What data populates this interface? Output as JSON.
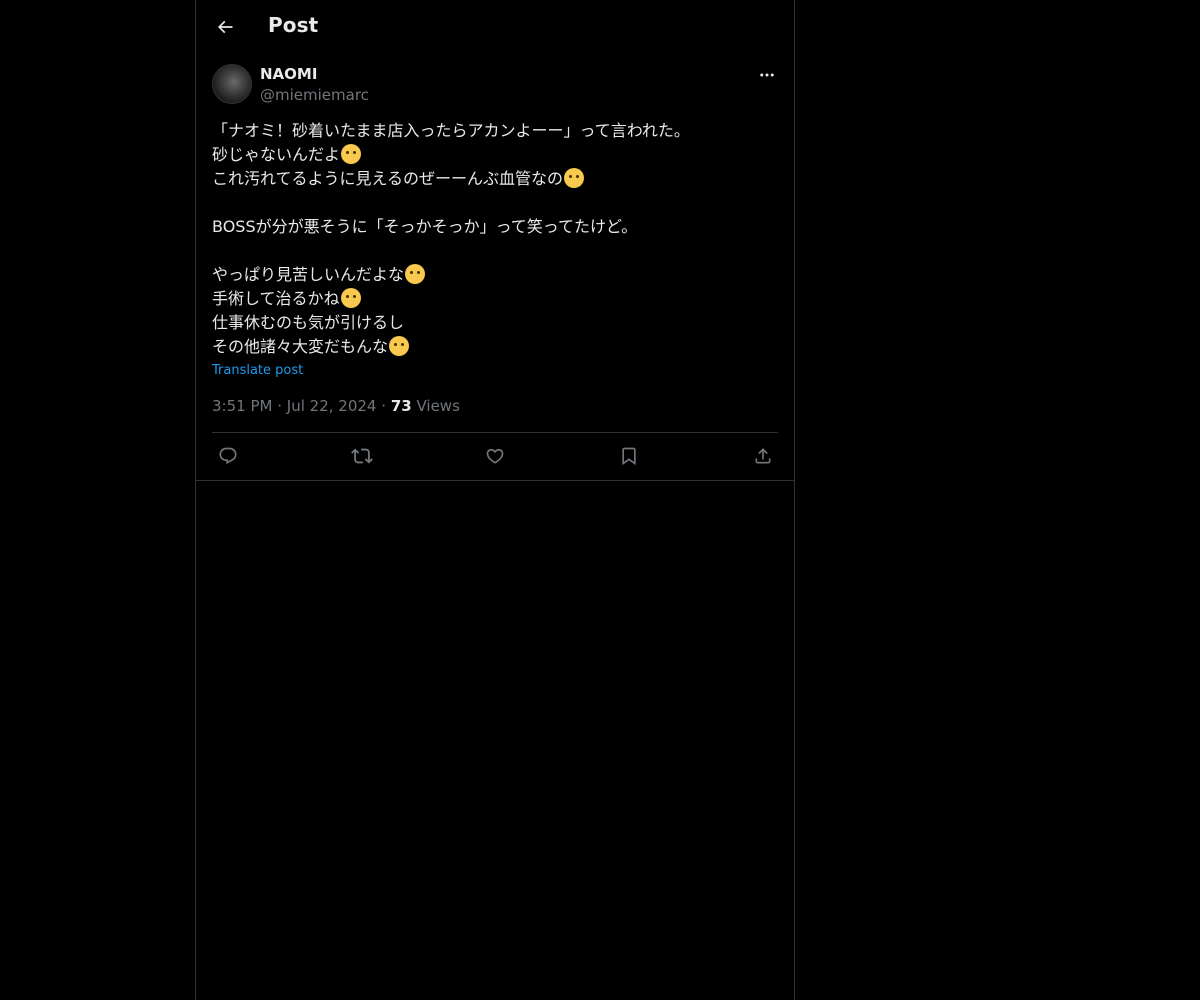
{
  "header": {
    "title": "Post",
    "back_icon": "arrow-left-icon"
  },
  "post": {
    "author": {
      "display_name": "NAOMI",
      "handle": "@miemiemarc"
    },
    "lines": [
      "「ナオミ！砂着いたまま店入ったらアカンよーー」って言われた。",
      "砂じゃないんだよ",
      "これ汚れてるように見えるのぜーーんぶ血管なの",
      "",
      "BOSSが分が悪そうに「そっかそっか」って笑ってたけど。",
      "",
      "やっぱり見苦しいんだよな",
      "手術して治るかね",
      "仕事休むのも気が引けるし",
      "その他諸々大変だもんな"
    ],
    "translate_label": "Translate post",
    "time": "3:51 PM",
    "date": "Jul 22, 2024",
    "separator": "·",
    "views_count": "73",
    "views_label": "Views"
  },
  "actions": {
    "reply_icon": "reply-icon",
    "repost_icon": "repost-icon",
    "like_icon": "heart-icon",
    "bookmark_icon": "bookmark-icon",
    "share_icon": "share-icon"
  },
  "colors": {
    "background": "#000000",
    "text": "#e7e9ea",
    "secondary_text": "#71767b",
    "link": "#1d9bf0",
    "border": "#2f3336"
  }
}
